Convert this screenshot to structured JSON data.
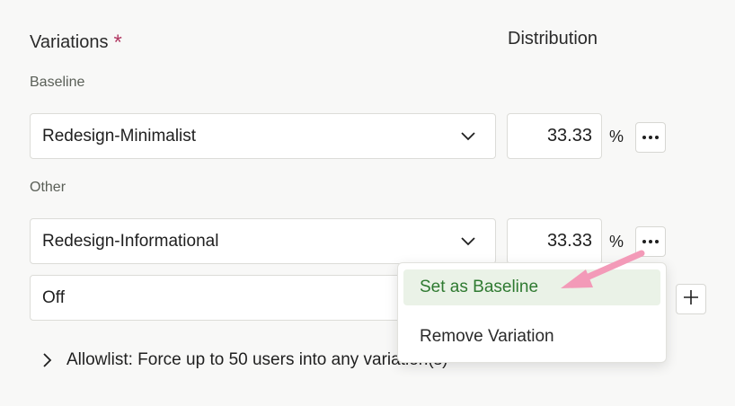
{
  "header": {
    "variations_label": "Variations",
    "required_marker": "*",
    "distribution_label": "Distribution"
  },
  "baseline": {
    "section_label": "Baseline",
    "variation": "Redesign-Minimalist",
    "distribution": "33.33",
    "unit": "%"
  },
  "other": {
    "section_label": "Other",
    "rows": [
      {
        "variation": "Redesign-Informational",
        "distribution": "33.33",
        "unit": "%"
      },
      {
        "variation": "Off"
      }
    ]
  },
  "menu": {
    "items": [
      "Set as Baseline",
      "Remove Variation"
    ]
  },
  "allowlist": {
    "label": "Allowlist: Force up to 50 users into any variation(s)"
  },
  "colors": {
    "accent_green": "#2f7a31",
    "menu_highlight": "#eaf2e7",
    "annotation_arrow": "#f39ab8",
    "required_star": "#b23a64"
  },
  "icons": [
    "chevron-down-icon",
    "more-horizontal-icon",
    "plus-icon",
    "chevron-right-icon",
    "annotation-arrow"
  ]
}
